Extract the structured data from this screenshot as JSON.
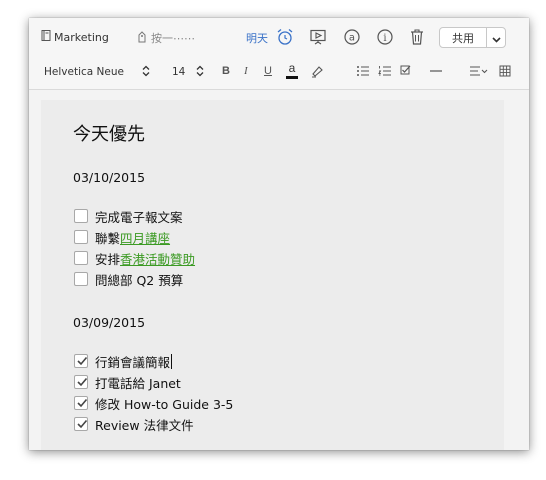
{
  "topbar": {
    "notebook_name": "Marketing",
    "tag_placeholder": "按一⋯⋯",
    "reminder_label": "明天",
    "share_label": "共用"
  },
  "format_bar": {
    "font_name": "Helvetica Neue",
    "font_size": "14",
    "bold": "B",
    "italic": "I",
    "underline": "U",
    "text_color": "a"
  },
  "note": {
    "title": "今天優先",
    "sections": [
      {
        "date": "03/10/2015",
        "tasks": [
          {
            "text": "完成電子報文案",
            "checked": false
          },
          {
            "text": "聯繫",
            "link": "四月講座",
            "checked": false
          },
          {
            "text": "安排",
            "link": "香港活動贊助",
            "checked": false
          },
          {
            "text": "問總部 Q2 預算",
            "checked": false
          }
        ]
      },
      {
        "date": "03/09/2015",
        "tasks": [
          {
            "text": "行銷會議簡報",
            "checked": true
          },
          {
            "text": "打電話給 Janet",
            "checked": true
          },
          {
            "text": "修改 How-to Guide 3-5",
            "checked": true
          },
          {
            "text": "Review 法律文件",
            "checked": true
          }
        ]
      }
    ]
  },
  "colors": {
    "link": "#3b9a23",
    "accent": "#3a72c8",
    "alarm": "#3a72c8"
  }
}
